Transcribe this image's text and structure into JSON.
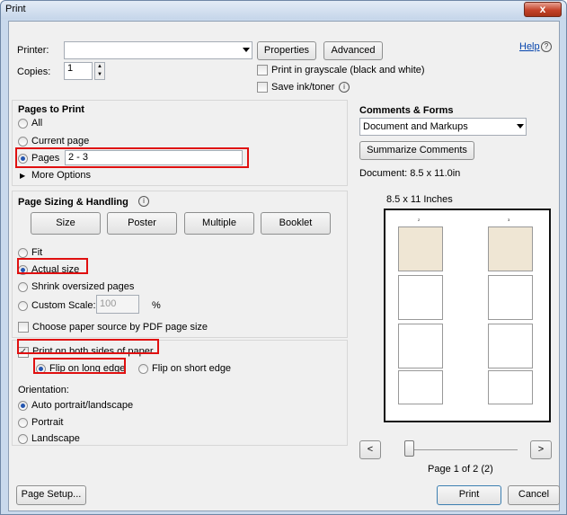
{
  "window": {
    "title": "Print",
    "close_label": "x"
  },
  "printer": {
    "printer_label": "Printer:",
    "printer_value": "",
    "properties_label": "Properties",
    "advanced_label": "Advanced",
    "help_label": "Help",
    "copies_label": "Copies:",
    "copies_value": "1",
    "grayscale_label": "Print in grayscale (black and white)",
    "save_ink_label": "Save ink/toner"
  },
  "pages_to_print": {
    "heading": "Pages to Print",
    "options": [
      "All",
      "Current page",
      "Pages"
    ],
    "pages_value": "2 - 3",
    "more_options_label": "More Options"
  },
  "sizing": {
    "heading": "Page Sizing & Handling",
    "tabs": [
      "Size",
      "Poster",
      "Multiple",
      "Booklet"
    ],
    "fit_label": "Fit",
    "actual_size_label": "Actual size",
    "shrink_label": "Shrink oversized pages",
    "custom_scale_label": "Custom Scale:",
    "custom_scale_value": "100",
    "percent_label": "%",
    "paper_source_label": "Choose paper source by PDF page size",
    "both_sides_label": "Print on both sides of paper",
    "flip_long_label": "Flip on long edge",
    "flip_short_label": "Flip on short edge",
    "orientation_label": "Orientation:",
    "orientation_options": [
      "Auto portrait/landscape",
      "Portrait",
      "Landscape"
    ]
  },
  "comments_forms": {
    "heading": "Comments & Forms",
    "selected": "Document and Markups",
    "summarize_label": "Summarize Comments"
  },
  "preview": {
    "document_label": "Document: 8.5 x 11.0in",
    "paper_label": "8.5 x 11 Inches",
    "page_indicator": "Page 1 of 2 (2)",
    "prev_label": "<",
    "next_label": ">",
    "slider_position": 0,
    "page_labels": [
      "2",
      "3"
    ]
  },
  "footer": {
    "page_setup_label": "Page Setup...",
    "print_label": "Print",
    "cancel_label": "Cancel"
  }
}
